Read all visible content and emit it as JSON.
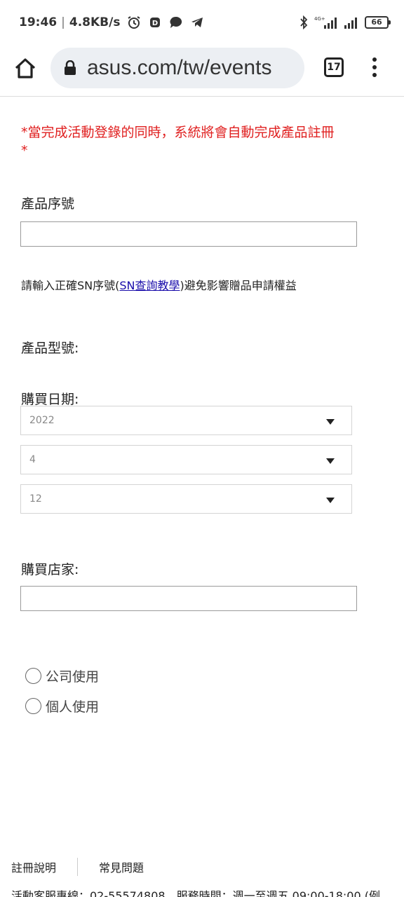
{
  "status_bar": {
    "time": "19:46",
    "speed": "4.8KB/s",
    "network": "4G+",
    "battery": "66",
    "icons": [
      "alarm-icon",
      "app-icon",
      "chat-icon",
      "telegram-icon",
      "bluetooth-icon",
      "signal-icon",
      "signal-icon-2",
      "battery-icon"
    ]
  },
  "browser": {
    "url": "asus.com/tw/events",
    "tab_count": "17"
  },
  "form": {
    "notice_line1": "*當完成活動登錄的同時，系統將會自動完成產品註冊",
    "notice_line2": "*",
    "serial_label": "產品序號",
    "serial_value": "",
    "hint_before": "請輸入正確SN序號(",
    "hint_link": "SN查詢教學",
    "hint_after": ")避免影響贈品申請權益",
    "model_label": "產品型號:",
    "date_label": "購買日期:",
    "date_year": "2022",
    "date_month": "4",
    "date_day": "12",
    "store_label": "購買店家:",
    "store_value": "",
    "usage_options": [
      "公司使用",
      "個人使用"
    ]
  },
  "footer": {
    "link_register": "註冊說明",
    "link_faq": "常見問題",
    "contact": "活動客服專線：02-55574808，服務時間：週一至週五 09:00-18:00 (例"
  }
}
